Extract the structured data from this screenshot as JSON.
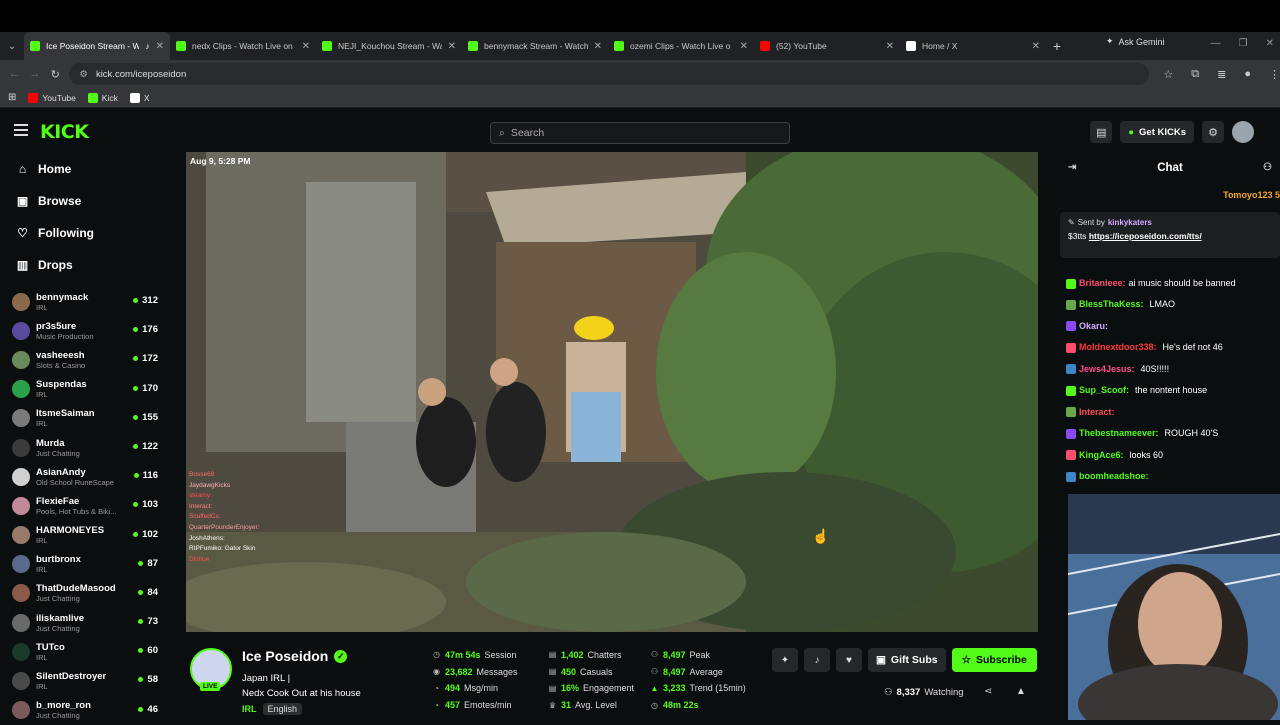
{
  "browser": {
    "tabs": [
      {
        "title": "Ice Poseidon Stream - W",
        "favicon_color": "#53fc18",
        "active": true,
        "audio": true
      },
      {
        "title": "nedx Clips - Watch Live on",
        "favicon_color": "#53fc18",
        "active": false
      },
      {
        "title": "NEJI_Kouchou Stream - Wa",
        "favicon_color": "#53fc18",
        "active": false
      },
      {
        "title": "bennymack Stream - Watch",
        "favicon_color": "#53fc18",
        "active": false
      },
      {
        "title": "ozemi Clips - Watch Live o",
        "favicon_color": "#53fc18",
        "active": false
      },
      {
        "title": "(52) YouTube",
        "favicon_color": "#ff0000",
        "active": false
      },
      {
        "title": "Home / X",
        "favicon_color": "#ffffff",
        "active": false
      }
    ],
    "gemini_label": "Ask Gemini",
    "url": "kick.com/iceposeidon",
    "bookmarks": [
      {
        "label": "YouTube",
        "color": "#ff0000"
      },
      {
        "label": "Kick",
        "color": "#53fc18"
      },
      {
        "label": "X",
        "color": "#ffffff"
      }
    ]
  },
  "header": {
    "logo": "KICK",
    "search_placeholder": "Search",
    "get_kicks_label": "Get KICKs",
    "accent": "#53fc18"
  },
  "sidebar": {
    "nav": [
      {
        "label": "Home",
        "icon": "home-icon"
      },
      {
        "label": "Browse",
        "icon": "browse-icon"
      },
      {
        "label": "Following",
        "icon": "heart-icon"
      },
      {
        "label": "Drops",
        "icon": "drops-icon"
      }
    ],
    "channels": [
      {
        "name": "bennymack",
        "category": "IRL",
        "viewers": "312",
        "color": "#8a6a4a"
      },
      {
        "name": "pr3s5ure",
        "category": "Music Production",
        "viewers": "176",
        "color": "#5a4aa0"
      },
      {
        "name": "vasheeesh",
        "category": "Slots & Casino",
        "viewers": "172",
        "color": "#6a8a5a"
      },
      {
        "name": "Suspendas",
        "category": "IRL",
        "viewers": "170",
        "color": "#2aa04a"
      },
      {
        "name": "ItsmeSaiman",
        "category": "IRL",
        "viewers": "155",
        "color": "#7a7a7a"
      },
      {
        "name": "Murda",
        "category": "Just Chatting",
        "viewers": "122",
        "color": "#3a3a3a"
      },
      {
        "name": "AsianAndy",
        "category": "Old School RuneScape",
        "viewers": "116",
        "color": "#d0d0d0"
      },
      {
        "name": "FlexieFae",
        "category": "Pools, Hot Tubs & Biki...",
        "viewers": "103",
        "color": "#c08a9a"
      },
      {
        "name": "HARMONEYES",
        "category": "IRL",
        "viewers": "102",
        "color": "#9a7a6a"
      },
      {
        "name": "burtbronx",
        "category": "IRL",
        "viewers": "87",
        "color": "#5a6a8a"
      },
      {
        "name": "ThatDudeMasood",
        "category": "Just Chatting",
        "viewers": "84",
        "color": "#8a5a4a"
      },
      {
        "name": "iliskamlive",
        "category": "Just Chatting",
        "viewers": "73",
        "color": "#6a6a6a"
      },
      {
        "name": "TUTco",
        "category": "IRL",
        "viewers": "60",
        "color": "#1a3a2a"
      },
      {
        "name": "SilentDestroyer",
        "category": "IRL",
        "viewers": "58",
        "color": "#4a4a4a"
      },
      {
        "name": "b_more_ron",
        "category": "Just Chatting",
        "viewers": "46",
        "color": "#7a5a5a"
      }
    ]
  },
  "video": {
    "timestamp": "Aug 9, 5:28 PM",
    "overlay_chat": [
      "Bosse69",
      "JaydawgKicks",
      "steamy:",
      "Interact:",
      "ScuffedCx:",
      "QuarterPounderEnjoyer:",
      "JoshAthens:",
      "RIPFumiko: Gator Skin",
      "Dlshue"
    ]
  },
  "stream": {
    "name": "Ice Poseidon",
    "live_label": "LIVE",
    "title_line1": "Japan IRL |",
    "title_line2": "Nedx Cook Out at his house",
    "category": "IRL",
    "language": "English",
    "stats": [
      {
        "value": "47m 54s",
        "label": "Session",
        "icon": "clock-icon"
      },
      {
        "value": "1,402",
        "label": "Chatters",
        "icon": "users-icon"
      },
      {
        "value": "8,497",
        "label": "Peak",
        "icon": "peak-icon"
      },
      {
        "value": "23,682",
        "label": "Messages",
        "icon": "messages-icon"
      },
      {
        "value": "450",
        "label": "Casuals",
        "icon": "casual-icon"
      },
      {
        "value": "8,497",
        "label": "Average",
        "icon": "average-icon"
      },
      {
        "value": "494",
        "label": "Msg/min",
        "icon": "speed-icon"
      },
      {
        "value": "16%",
        "label": "Engagement",
        "icon": "engagement-icon"
      },
      {
        "value": "3,233",
        "label": "Trend (15min)",
        "icon": "trend-icon"
      },
      {
        "value": "457",
        "label": "Emotes/min",
        "icon": "emote-icon"
      },
      {
        "value": "31",
        "label": "Avg. Level",
        "icon": "trophy-icon"
      },
      {
        "value": "48m 22s",
        "label": "",
        "icon": "timer-icon"
      }
    ],
    "gift_subs_label": "Gift Subs",
    "subscribe_label": "Subscribe",
    "watching_count": "8,337",
    "watching_label": "Watching"
  },
  "chat": {
    "title": "Chat",
    "top_gifter": "Tomoyo123",
    "top_gifter_count": "5",
    "pinned_sent_by_label": "Sent by",
    "pinned_sender": "kinkykaters",
    "pinned_prefix": "$3tts",
    "pinned_link": "https://iceposeidon.com/tts/",
    "messages": [
      {
        "user": "Britanieee:",
        "text": "ai music should be banned",
        "color": "#ff4d6d"
      },
      {
        "user": "BlessThaKess:",
        "text": "LMAO",
        "color": "#53fc18"
      },
      {
        "user": "Okaru:",
        "text": "",
        "color": "#d6a8ff"
      },
      {
        "user": "Moldnextdoor338:",
        "text": "He's def not 46",
        "color": "#ff3a3a"
      },
      {
        "user": "Jews4Jesus:",
        "text": "40S!!!!!",
        "color": "#ff4d8a"
      },
      {
        "user": "Sup_Scoof:",
        "text": "the nontent house",
        "color": "#53fc18"
      },
      {
        "user": "Interact:",
        "text": "",
        "color": "#ff4d4d"
      },
      {
        "user": "Thebestnameever:",
        "text": "ROUGH 40'S",
        "color": "#53fc18"
      },
      {
        "user": "KingAce6:",
        "text": "looks 60",
        "color": "#53fc18"
      },
      {
        "user": "boomheadshoe:",
        "text": "",
        "color": "#53fc18"
      }
    ]
  }
}
